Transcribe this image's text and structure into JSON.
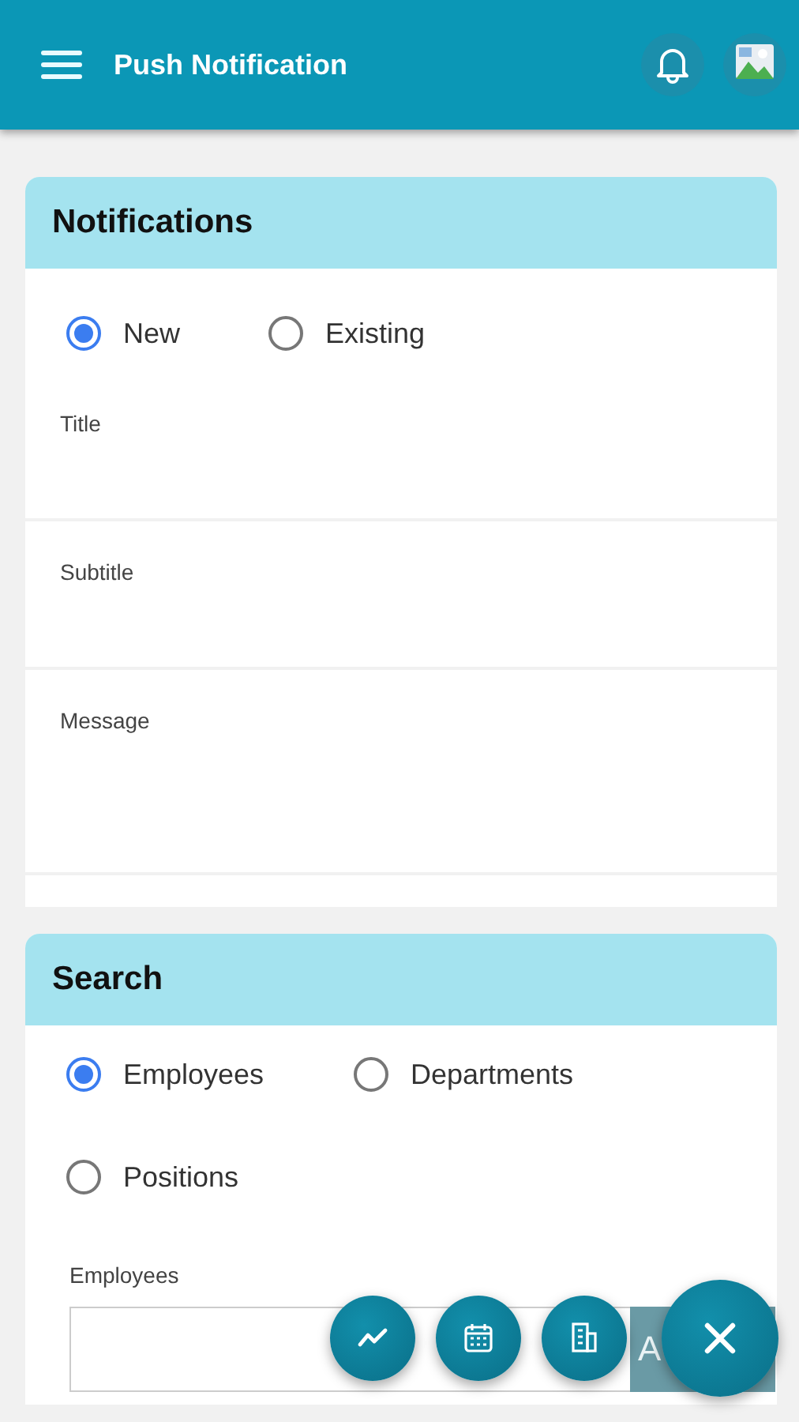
{
  "app_bar": {
    "title": "Push Notification"
  },
  "notifications": {
    "heading": "Notifications",
    "options": [
      {
        "label": "New",
        "selected": true
      },
      {
        "label": "Existing",
        "selected": false
      }
    ],
    "fields": [
      {
        "label": "Title",
        "kind": "text"
      },
      {
        "label": "Subtitle",
        "kind": "text"
      },
      {
        "label": "Message",
        "kind": "multiline"
      }
    ]
  },
  "search": {
    "heading": "Search",
    "options": [
      {
        "label": "Employees",
        "selected": true
      },
      {
        "label": "Departments",
        "selected": false
      },
      {
        "label": "Positions",
        "selected": false
      }
    ],
    "field": {
      "label": "Employees",
      "button": "A"
    }
  },
  "fab_menu": {
    "expanded": true,
    "actions": [
      {
        "kind": "chart"
      },
      {
        "kind": "calendar"
      },
      {
        "kind": "building"
      }
    ]
  }
}
